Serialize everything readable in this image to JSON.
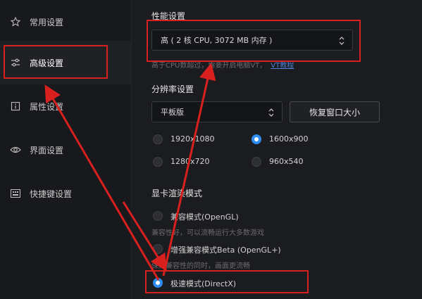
{
  "sidebar": {
    "items": [
      {
        "label": "常用设置",
        "icon": "star-icon"
      },
      {
        "label": "高级设置",
        "icon": "sliders-icon"
      },
      {
        "label": "属性设置",
        "icon": "info-icon"
      },
      {
        "label": "界面设置",
        "icon": "eye-icon"
      },
      {
        "label": "快捷键设置",
        "icon": "keyboard-icon"
      }
    ],
    "active_index": 1
  },
  "performance": {
    "title": "性能设置",
    "selected": "高 ( 2 核 CPU, 3072 MB 内存 )",
    "note": "高于CPU数超过，需要开启电脑VT，",
    "note_link": "VT教程"
  },
  "resolution": {
    "title": "分辨率设置",
    "mode_selected": "平板版",
    "restore_button": "恢复窗口大小",
    "options": [
      {
        "label": "1920x1080",
        "selected": false
      },
      {
        "label": "1600x900",
        "selected": true
      },
      {
        "label": "1280x720",
        "selected": false
      },
      {
        "label": "960x540",
        "selected": false
      }
    ]
  },
  "render": {
    "title": "显卡渲染模式",
    "options": [
      {
        "label": "兼容模式(OpenGL)",
        "desc": "兼容性好，可以流畅运行大多数游戏",
        "selected": false
      },
      {
        "label": "增强兼容模式Beta (OpenGL+)",
        "desc": "保持兼容性的同时，画面更流畅",
        "selected": false
      },
      {
        "label": "极速模式(DirectX)",
        "desc": "",
        "selected": true
      }
    ]
  },
  "colors": {
    "highlight": "#d8201f",
    "accent": "#2f8cf0",
    "background": "#1b1c1f"
  }
}
